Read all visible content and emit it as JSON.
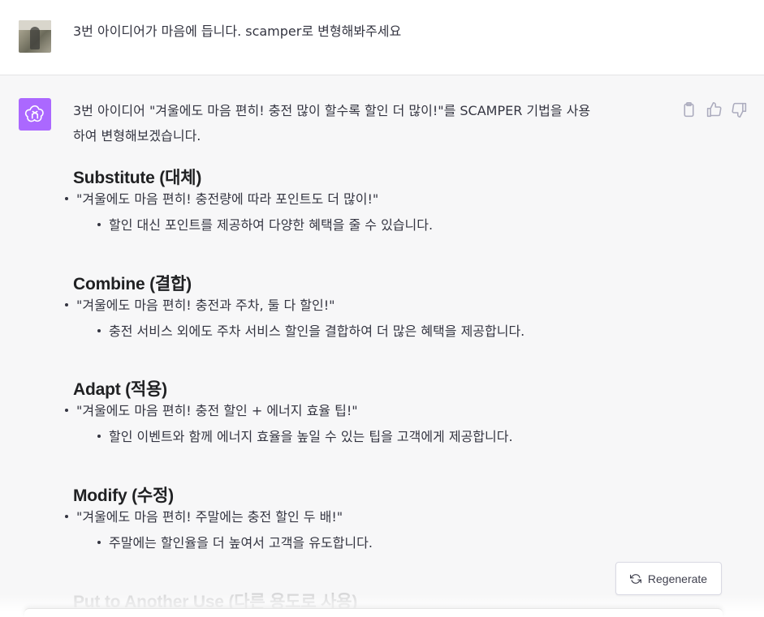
{
  "user_message": {
    "text": "3번 아이디어가 마음에 듭니다. scamper로 변형해봐주세요"
  },
  "assistant_message": {
    "intro_line1": "3번 아이디어 \"겨울에도 마음 편히! 충전 많이 할수록 할인 더 많이!\"를 SCAMPER 기법을 사용",
    "intro_line2": "하여 변형해보겠습니다.",
    "sections": [
      {
        "heading": "Substitute (대체)",
        "bullet": "\"겨울에도 마음 편히! 충전량에 따라 포인트도 더 많이!\"",
        "sub_bullet": "할인 대신 포인트를 제공하여 다양한 혜택을 줄 수 있습니다."
      },
      {
        "heading": "Combine (결합)",
        "bullet": "\"겨울에도 마음 편히! 충전과 주차, 둘 다 할인!\"",
        "sub_bullet": "충전 서비스 외에도 주차 서비스 할인을 결합하여 더 많은 혜택을 제공합니다."
      },
      {
        "heading": "Adapt (적용)",
        "bullet": "\"겨울에도 마음 편히! 충전 할인 + 에너지 효율 팁!\"",
        "sub_bullet": "할인 이벤트와 함께 에너지 효율을 높일 수 있는 팁을 고객에게 제공합니다."
      },
      {
        "heading": "Modify (수정)",
        "bullet": "\"겨울에도 마음 편히! 주말에는 충전 할인 두 배!\"",
        "sub_bullet": "주말에는 할인율을 더 높여서 고객을 유도합니다."
      },
      {
        "heading": "Put to Another Use (다른 용도로 사용)"
      }
    ]
  },
  "regenerate_button": {
    "label": "Regenerate"
  },
  "icons": {
    "copy": "clipboard-icon",
    "thumbs_up": "thumbs-up-icon",
    "thumbs_down": "thumbs-down-icon",
    "regenerate": "refresh-icon",
    "assistant_logo": "openai-logo-icon"
  },
  "colors": {
    "assistant_avatar_bg": "#ab68ff",
    "assistant_row_bg": "#f7f7f8",
    "text": "#343541"
  }
}
